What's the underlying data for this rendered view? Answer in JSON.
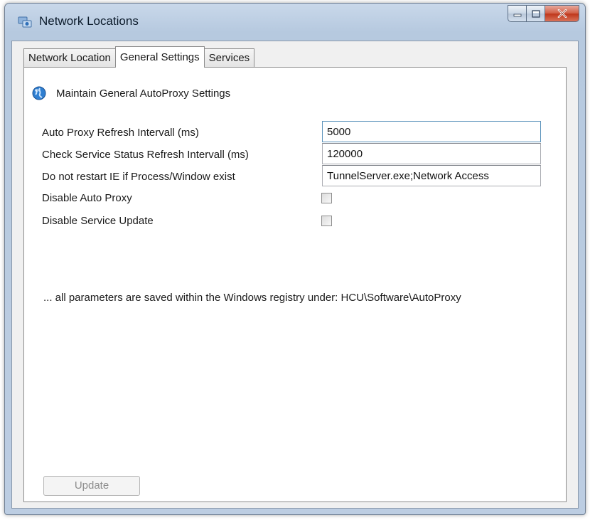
{
  "window": {
    "title": "Network Locations"
  },
  "tabs": [
    {
      "label": "Network Location",
      "active": false
    },
    {
      "label": "General Settings",
      "active": true
    },
    {
      "label": "Services",
      "active": false
    }
  ],
  "panel": {
    "header": "Maintain General AutoProxy Settings",
    "fields": [
      {
        "label": "Auto Proxy Refresh Intervall (ms)",
        "value": "5000"
      },
      {
        "label": "Check Service Status Refresh Intervall (ms)",
        "value": "120000"
      },
      {
        "label": "Do not restart IE if Process/Window exist",
        "value": "TunnelServer.exe;Network Access"
      }
    ],
    "checkboxes": [
      {
        "label": "Disable Auto Proxy",
        "checked": false
      },
      {
        "label": "Disable Service Update",
        "checked": false
      }
    ],
    "note": "... all parameters are saved within the Windows registry under: HCU\\Software\\AutoProxy",
    "update_button": "Update"
  },
  "icons": {
    "app": "network-locations-icon",
    "header": "globe-icon",
    "minimize": "minimize-icon",
    "maximize": "maximize-icon",
    "close": "close-icon"
  },
  "colors": {
    "titlebar": "#b6c9df",
    "close_button": "#c0391d",
    "client_bg": "#f0f0f0",
    "panel_bg": "#ffffff",
    "focus_border": "#5c93bc"
  }
}
